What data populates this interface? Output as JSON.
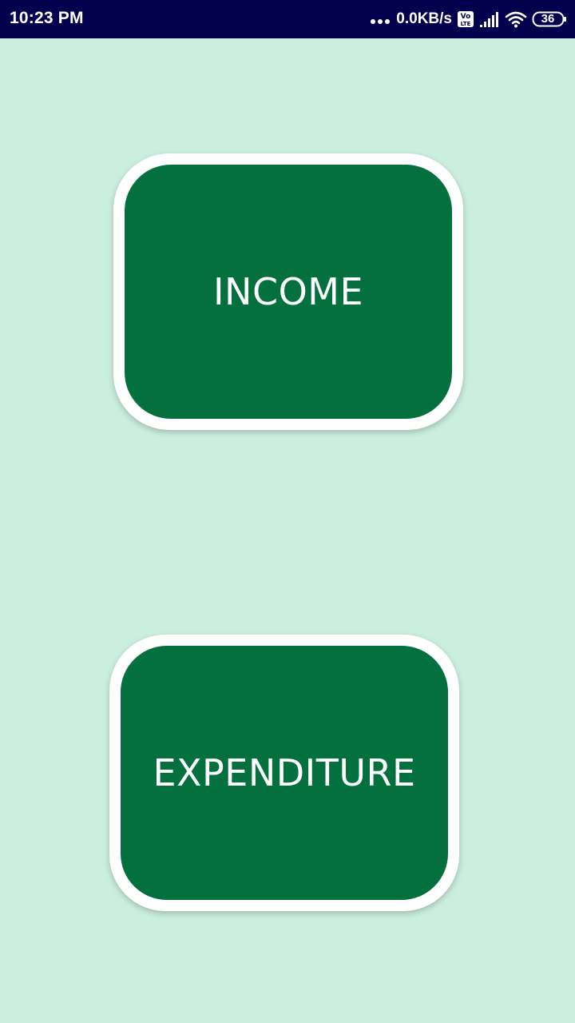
{
  "theme": {
    "status_bar_bg": "#03004d",
    "page_bg": "#cbefdf",
    "button_bg": "#03703e",
    "button_border": "#ffffff",
    "text_color": "#ffffff"
  },
  "status_bar": {
    "time": "10:23 PM",
    "network_speed": "0.0KB/s",
    "volte_top": "Vo",
    "volte_bottom": "LTE",
    "battery_level": "36",
    "icons": [
      "more-dots-icon",
      "volte-icon",
      "signal-icon",
      "wifi-icon",
      "battery-icon"
    ]
  },
  "buttons": {
    "income_label": "INCOME",
    "expenditure_label": "EXPENDITURE"
  }
}
